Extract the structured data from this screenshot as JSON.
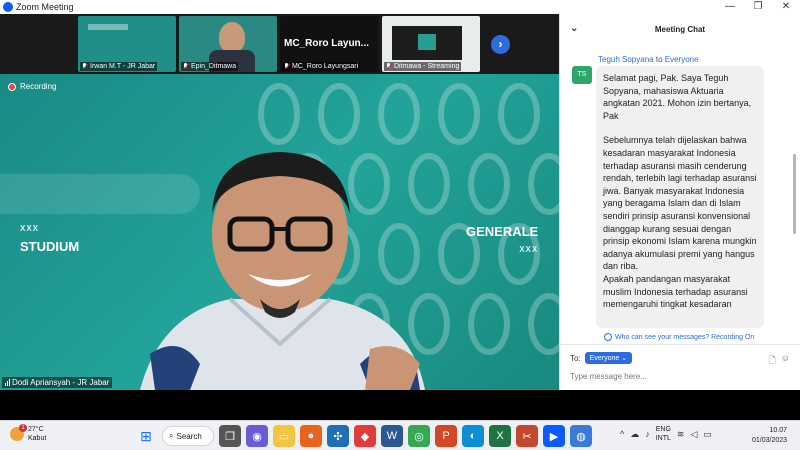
{
  "window": {
    "title": "Zoom Meeting",
    "minimize": "—",
    "maximize": "❐",
    "close": "✕"
  },
  "thumbnails": [
    {
      "name": "Irwan M.T - JR Jabar",
      "bg": "#1f8f88"
    },
    {
      "name": "Epin_Ditmawa",
      "bg": "#2a8a83"
    },
    {
      "name": "MC_Roro Layungsari",
      "bg": "#111111",
      "big_text": "MC_Roro  Layun..."
    },
    {
      "name": "Ditmawa - Streaming",
      "bg": "#e8ecec"
    }
  ],
  "thumb_nav": "›",
  "main_video": {
    "recording_label": "Recording",
    "brand_left": "STUDIUM",
    "brand_right": "GENERALE",
    "brand_dots": "XXX",
    "speaker_name": "Dodi Apriansyah - JR Jabar"
  },
  "chat": {
    "title": "Meeting Chat",
    "sender": "Teguh Sopyana",
    "to_word": "to",
    "recipient": "Everyone",
    "avatar": "TS",
    "message_p1": "Selamat pagi, Pak. Saya Teguh Sopyana, mahasiswa Aktuaria angkatan 2021. Mohon izin bertanya, Pak",
    "message_p2": "Sebelumnya telah dijelaskan bahwa kesadaran masyarakat Indonesia terhadap asuransi masih cenderung rendah, terlebih lagi terhadap asuransi jiwa. Banyak masyarakat Indonesia yang beragama Islam dan di Islam sendiri prinsip asuransi konvensional dianggap kurang sesuai dengan prinsip ekonomi Islam karena mungkin adanya akumulasi premi yang hangus dan riba.",
    "message_p3": "Apakah pandangan masyarakat muslim Indonesia terhadap asuransi memengaruhi tingkat kesadaran",
    "who_can_see": "Who can see your messages? Recording On",
    "to_label": "To:",
    "to_value": "Everyone",
    "input_placeholder": "Type message here..."
  },
  "taskbar": {
    "temp": "27°C",
    "weather": "Kabut",
    "weather_badge": "1",
    "search_label": "Search",
    "lang_top": "ENG",
    "lang_bottom": "INTL",
    "time": "10.07",
    "date": "01/03/2023"
  }
}
